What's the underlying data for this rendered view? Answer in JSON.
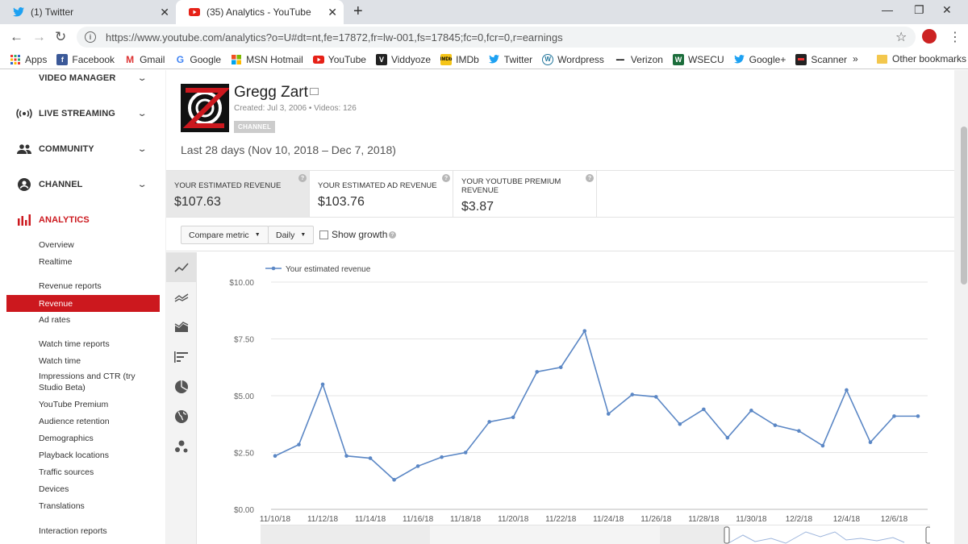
{
  "browser": {
    "tabs": [
      {
        "label": "(1) Twitter",
        "icon": "twitter-bird-icon"
      },
      {
        "label": "(35) Analytics - YouTube",
        "icon": "youtube-icon"
      }
    ],
    "url": "https://www.youtube.com/analytics?o=U#dt=nt,fe=17872,fr=lw-001,fs=17845;fc=0,fcr=0,r=earnings",
    "bookmarks": [
      "Apps",
      "Facebook",
      "Gmail",
      "Google",
      "MSN Hotmail",
      "YouTube",
      "Viddyoze",
      "IMDb",
      "Twitter",
      "Wordpress",
      "Verizon",
      "WSECU",
      "Google+",
      "Scanner"
    ],
    "bookmarks_more": "»",
    "other_bookmarks": "Other bookmarks"
  },
  "sidebar": {
    "sections": [
      {
        "label": "VIDEO MANAGER",
        "icon": "video-manager-icon"
      },
      {
        "label": "LIVE STREAMING",
        "icon": "live-streaming-icon"
      },
      {
        "label": "COMMUNITY",
        "icon": "community-icon"
      },
      {
        "label": "CHANNEL",
        "icon": "channel-icon"
      },
      {
        "label": "ANALYTICS",
        "icon": "analytics-icon"
      }
    ],
    "analytics_items": [
      "Overview",
      "Realtime",
      "Revenue reports",
      "Revenue",
      "Ad rates",
      "Watch time reports",
      "Watch time",
      "Impressions and CTR (try",
      "Studio Beta)",
      "YouTube Premium",
      "Audience retention",
      "Demographics",
      "Playback locations",
      "Traffic sources",
      "Devices",
      "Translations",
      "Interaction reports"
    ],
    "selected": "Revenue"
  },
  "channel": {
    "name": "Gregg Zart",
    "created": "Created: Jul 3, 2006",
    "videos": "Videos: 126",
    "badge": "CHANNEL"
  },
  "date_range": "Last 28 days (Nov 10, 2018 – Dec 7, 2018)",
  "metrics": [
    {
      "label": "YOUR ESTIMATED REVENUE",
      "value": "$107.63"
    },
    {
      "label": "YOUR ESTIMATED AD REVENUE",
      "value": "$103.76"
    },
    {
      "label": "YOUR YOUTUBE PREMIUM REVENUE",
      "value": "$3.87"
    }
  ],
  "toolbar": {
    "compare_metric": "Compare metric",
    "granularity": "Daily",
    "show_growth": "Show growth"
  },
  "colors": {
    "accent": "#cc181e",
    "series": "#5b87c5"
  },
  "chart_data": {
    "type": "line",
    "series": [
      {
        "name": "Your estimated revenue",
        "values": [
          2.35,
          2.85,
          5.5,
          2.35,
          2.25,
          1.3,
          1.9,
          2.3,
          2.5,
          3.85,
          4.05,
          6.05,
          6.25,
          7.85,
          4.2,
          5.05,
          4.95,
          3.75,
          4.4,
          3.15,
          4.35,
          3.7,
          3.45,
          2.8,
          5.25,
          2.95,
          4.1,
          4.1
        ]
      }
    ],
    "x": [
      "11/10/18",
      "11/11/18",
      "11/12/18",
      "11/13/18",
      "11/14/18",
      "11/15/18",
      "11/16/18",
      "11/17/18",
      "11/18/18",
      "11/19/18",
      "11/20/18",
      "11/21/18",
      "11/22/18",
      "11/23/18",
      "11/24/18",
      "11/25/18",
      "11/26/18",
      "11/27/18",
      "11/28/18",
      "11/29/18",
      "11/30/18",
      "12/1/18",
      "12/2/18",
      "12/3/18",
      "12/4/18",
      "12/5/18",
      "12/6/18",
      "12/7/18"
    ],
    "x_tick_labels": [
      "11/10/18",
      "11/12/18",
      "11/14/18",
      "11/16/18",
      "11/18/18",
      "11/20/18",
      "11/22/18",
      "11/24/18",
      "11/26/18",
      "11/28/18",
      "11/30/18",
      "12/2/18",
      "12/4/18",
      "12/6/18"
    ],
    "y_tick_labels": [
      "$10.00",
      "$7.50",
      "$5.00",
      "$2.50",
      "$0.00"
    ],
    "ylim": [
      0,
      10
    ],
    "grid": true,
    "legend": "top-left"
  }
}
